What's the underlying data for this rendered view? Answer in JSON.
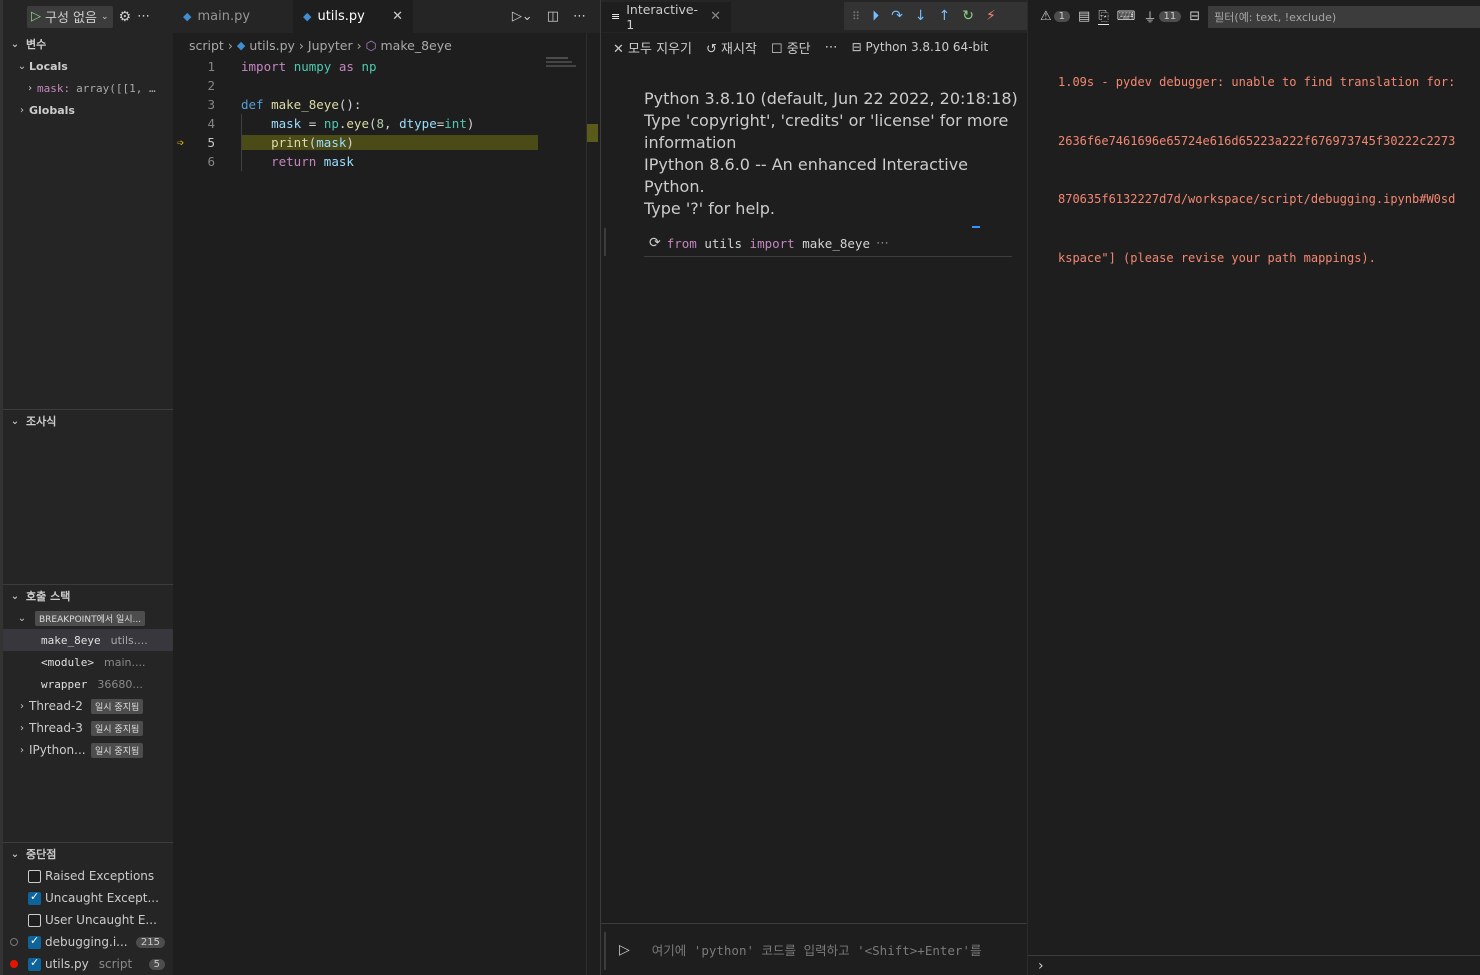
{
  "debug": {
    "config_label": "구성 없음",
    "variables_title": "변수",
    "locals_label": "Locals",
    "mask_name": "mask:",
    "mask_value": "array([[1, …",
    "globals_label": "Globals",
    "watch_title": "조사식",
    "callstack_title": "호출 스택",
    "breakpoint_badge": "BREAKPOINT에서 일시...",
    "frames": [
      {
        "name": "make_8eye",
        "file": "utils...."
      },
      {
        "name": "<module>",
        "file": "main...."
      },
      {
        "name": "wrapper",
        "file": "36680..."
      }
    ],
    "threads": [
      {
        "name": "Thread-2",
        "state": "일시 중지됨"
      },
      {
        "name": "Thread-3",
        "state": "일시 중지됨"
      },
      {
        "name": "IPython...",
        "state": "일시 중지됨"
      }
    ],
    "breakpoints_title": "중단점",
    "breakpoints": [
      {
        "label": "Raised Exceptions",
        "checked": false
      },
      {
        "label": "Uncaught Except...",
        "checked": true
      },
      {
        "label": "User Uncaught E...",
        "checked": false
      }
    ],
    "bp_files": [
      {
        "label": "debugging.i...",
        "count": "215",
        "detail": ""
      },
      {
        "label": "utils.py",
        "detail": "script",
        "count": "5"
      }
    ]
  },
  "editor": {
    "tabs": [
      "main.py",
      "utils.py"
    ],
    "breadcrumb": [
      "script",
      "utils.py",
      "Jupyter",
      "make_8eye"
    ],
    "line_numbers": [
      "1",
      "2",
      "3",
      "4",
      "5",
      "6"
    ]
  },
  "interactive": {
    "tab_label": "Interactive-1",
    "clear_all": "모두 지우기",
    "restart": "재시작",
    "interrupt": "중단",
    "kernel": "Python 3.8.10 64-bit",
    "banner": [
      "Python 3.8.10 (default, Jun 22 2022, 20:18:18)",
      "Type 'copyright', 'credits' or 'license' for more",
      "information",
      "IPython 8.6.0 -- An enhanced Interactive Python.",
      "Type '?' for help."
    ],
    "cell_kw_from": "from",
    "cell_mod": "utils",
    "cell_kw_import": "import",
    "cell_name": "make_8eye",
    "input_placeholder": "여기에 'python' 코드를 입력하고 '<Shift>+Enter'를"
  },
  "output": {
    "problems_count": "1",
    "ports_count": "11",
    "filter_placeholder": "필터(예: text, !exclude)",
    "lines": [
      "1.09s - pydev debugger: unable to find translation for:",
      "2636f6e7461696e65724e616d65223a222f676973745f30222c2273",
      "870635f6132227d7d/workspace/script/debugging.ipynb#W0sd",
      "kspace\"] (please revise your path mappings)."
    ]
  }
}
